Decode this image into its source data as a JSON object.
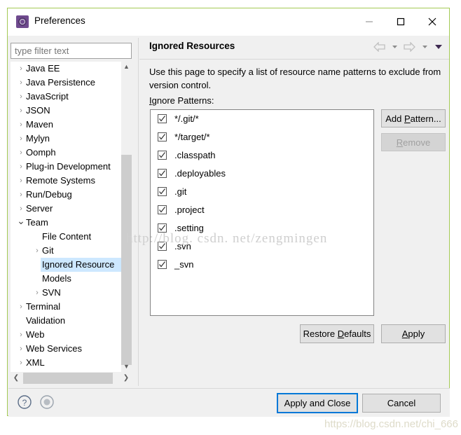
{
  "window": {
    "title": "Preferences",
    "icon": "preferences-gear-icon",
    "accent_border": "#a3c954",
    "controls": {
      "minimize": "minimize-icon",
      "maximize": "maximize-icon",
      "close": "close-icon"
    }
  },
  "filter": {
    "placeholder": "type filter text",
    "value": ""
  },
  "tree": {
    "items": [
      {
        "label": "Java EE",
        "indent": 0,
        "twisty": "collapsed",
        "selected": false
      },
      {
        "label": "Java Persistence",
        "indent": 0,
        "twisty": "collapsed",
        "selected": false
      },
      {
        "label": "JavaScript",
        "indent": 0,
        "twisty": "collapsed",
        "selected": false
      },
      {
        "label": "JSON",
        "indent": 0,
        "twisty": "collapsed",
        "selected": false
      },
      {
        "label": "Maven",
        "indent": 0,
        "twisty": "collapsed",
        "selected": false
      },
      {
        "label": "Mylyn",
        "indent": 0,
        "twisty": "collapsed",
        "selected": false
      },
      {
        "label": "Oomph",
        "indent": 0,
        "twisty": "collapsed",
        "selected": false
      },
      {
        "label": "Plug-in Development",
        "indent": 0,
        "twisty": "collapsed",
        "selected": false
      },
      {
        "label": "Remote Systems",
        "indent": 0,
        "twisty": "collapsed",
        "selected": false
      },
      {
        "label": "Run/Debug",
        "indent": 0,
        "twisty": "collapsed",
        "selected": false
      },
      {
        "label": "Server",
        "indent": 0,
        "twisty": "collapsed",
        "selected": false
      },
      {
        "label": "Team",
        "indent": 0,
        "twisty": "expanded",
        "selected": false
      },
      {
        "label": "File Content",
        "indent": 1,
        "twisty": "none",
        "selected": false
      },
      {
        "label": "Git",
        "indent": 1,
        "twisty": "collapsed",
        "selected": false
      },
      {
        "label": "Ignored Resource",
        "indent": 1,
        "twisty": "none",
        "selected": true
      },
      {
        "label": "Models",
        "indent": 1,
        "twisty": "none",
        "selected": false
      },
      {
        "label": "SVN",
        "indent": 1,
        "twisty": "collapsed",
        "selected": false
      },
      {
        "label": "Terminal",
        "indent": 0,
        "twisty": "collapsed",
        "selected": false
      },
      {
        "label": "Validation",
        "indent": 0,
        "twisty": "none",
        "selected": false
      },
      {
        "label": "Web",
        "indent": 0,
        "twisty": "collapsed",
        "selected": false
      },
      {
        "label": "Web Services",
        "indent": 0,
        "twisty": "collapsed",
        "selected": false
      },
      {
        "label": "XML",
        "indent": 0,
        "twisty": "collapsed",
        "selected": false
      }
    ],
    "selection_color": "#cde8ff",
    "scrollbars": {
      "vertical": {
        "up": "scroll-up-icon",
        "down": "scroll-down-icon"
      },
      "horizontal": {
        "left": "scroll-left-icon",
        "right": "scroll-right-icon"
      }
    }
  },
  "page": {
    "title": "Ignored Resources",
    "description": "Use this page to specify a list of resource name patterns to exclude from version control.",
    "patterns_label_mnemonic": "I",
    "patterns_label_rest": "gnore Patterns:",
    "nav": {
      "back": "back-arrow-icon",
      "back_menu": "back-dropdown-icon",
      "forward": "forward-arrow-icon",
      "forward_menu": "forward-dropdown-icon",
      "view_menu": "view-menu-icon"
    },
    "patterns": [
      {
        "label": "*/.git/*",
        "checked": true
      },
      {
        "label": "*/target/*",
        "checked": true
      },
      {
        "label": ".classpath",
        "checked": true
      },
      {
        "label": ".deployables",
        "checked": true
      },
      {
        "label": ".git",
        "checked": true
      },
      {
        "label": ".project",
        "checked": true
      },
      {
        "label": ".setting",
        "checked": true
      },
      {
        "label": ".svn",
        "checked": true
      },
      {
        "label": "_svn",
        "checked": true
      }
    ],
    "buttons": {
      "add_pattern_pre": "Add ",
      "add_pattern_mnemonic": "P",
      "add_pattern_post": "attern...",
      "remove_mnemonic": "R",
      "remove_post": "emove",
      "remove_enabled": false,
      "restore_defaults_pre": "Restore ",
      "restore_defaults_mnemonic": "D",
      "restore_defaults_post": "efaults",
      "apply_mnemonic": "A",
      "apply_post": "pply"
    }
  },
  "footer": {
    "help_icon": "help-icon",
    "nav_icon": "navigation-circle-icon",
    "apply_and_close": "Apply and Close",
    "cancel": "Cancel",
    "focus_color": "#0078d7"
  },
  "watermarks": {
    "center": "http://blog. csdn. net/zengmingen",
    "bottom": "https://blog.csdn.net/chi_666"
  }
}
